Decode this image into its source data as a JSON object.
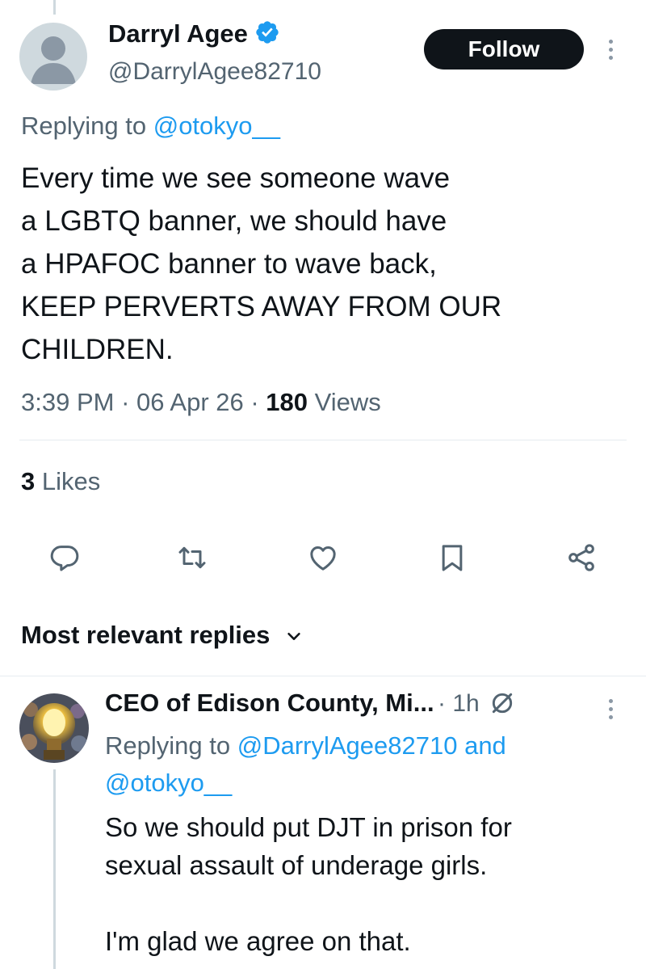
{
  "tweet": {
    "author_name": "Darryl Agee",
    "author_handle": "@DarrylAgee82710",
    "follow_label": "Follow",
    "replying_prefix": "Replying to",
    "replying_handle": "@otokyo__",
    "text": "Every time we see someone wave\na LGBTQ banner, we should have\na HPAFOC banner to wave back,\nKEEP PERVERTS AWAY FROM OUR\nCHILDREN.",
    "time": "3:39 PM",
    "date": "06 Apr 26",
    "views_count": "180",
    "views_label": "Views",
    "likes_count": "3",
    "likes_label": "Likes"
  },
  "actions": [
    "reply-icon",
    "retweet-icon",
    "like-icon",
    "bookmark-icon",
    "share-icon"
  ],
  "replies_section": {
    "title": "Most relevant replies"
  },
  "reply": {
    "author_name": "CEO of Edison County, Mi...",
    "time": "1h",
    "replying_prefix": "Replying to",
    "replying_handle1": "@DarrylAgee82710",
    "and_label": "and",
    "replying_handle2": "@otokyo__",
    "text": "So we should put DJT in prison for\nsexual assault of underage girls.\n\nI'm glad we agree on that."
  },
  "colors": {
    "link": "#1d9bf0",
    "verified": "#1d9bf0",
    "secondary_text": "#536471"
  }
}
